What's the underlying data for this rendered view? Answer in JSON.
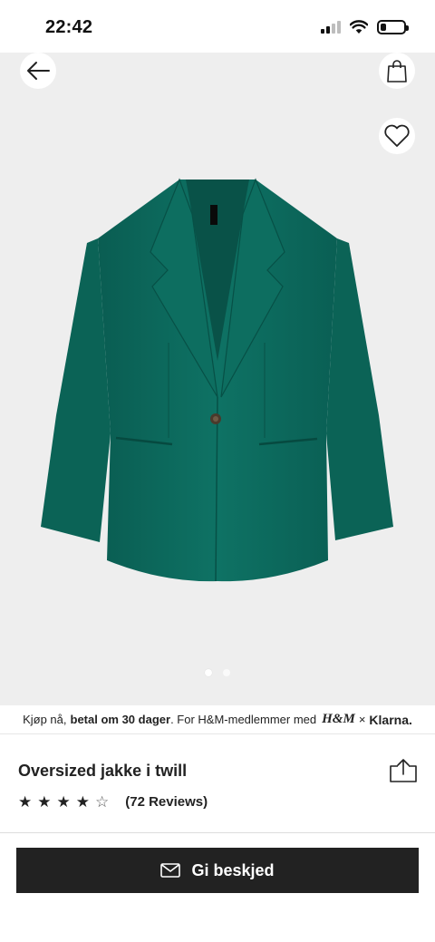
{
  "status_bar": {
    "time": "22:42",
    "signal_bars_active": 2,
    "signal_bars_total": 4,
    "battery_level": 0.25,
    "icons": [
      "signal-icon",
      "wifi-icon",
      "battery-icon"
    ]
  },
  "header": {
    "back_icon": "arrow-left-icon",
    "bag_icon": "shopping-bag-icon",
    "favorite_icon": "heart-icon"
  },
  "gallery": {
    "image_count": 2,
    "active_index": 0,
    "product_color": "#0b6b5f"
  },
  "promo": {
    "prefix": "Kjøp nå,",
    "bold": "betal om 30 dager",
    "suffix": ". For H&M-medlemmer med",
    "hm_logo": "H&M",
    "separator": "×",
    "klarna": "Klarna."
  },
  "product": {
    "title": "Oversized jakke i twill",
    "rating": 4,
    "rating_max": 5,
    "reviews": "(72 Reviews)",
    "share_icon": "share-icon"
  },
  "cta": {
    "label": "Gi beskjed",
    "icon": "envelope-icon",
    "background": "#222222"
  }
}
